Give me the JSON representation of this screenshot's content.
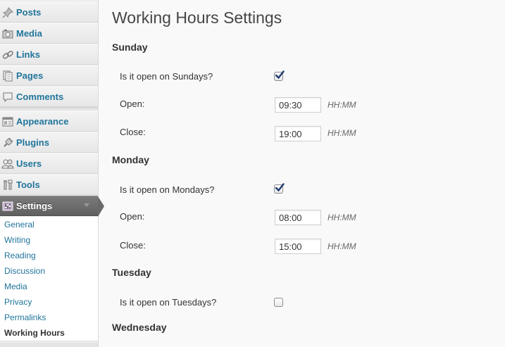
{
  "sidebar": {
    "items": [
      {
        "label": "Posts",
        "icon": "pushpin-icon"
      },
      {
        "label": "Media",
        "icon": "media-icon"
      },
      {
        "label": "Links",
        "icon": "link-icon"
      },
      {
        "label": "Pages",
        "icon": "pages-icon"
      },
      {
        "label": "Comments",
        "icon": "comment-icon"
      },
      {
        "label": "Appearance",
        "icon": "appearance-icon"
      },
      {
        "label": "Plugins",
        "icon": "plug-icon"
      },
      {
        "label": "Users",
        "icon": "users-icon"
      },
      {
        "label": "Tools",
        "icon": "tools-icon"
      },
      {
        "label": "Settings",
        "icon": "settings-icon"
      }
    ],
    "settings_submenu": [
      "General",
      "Writing",
      "Reading",
      "Discussion",
      "Media",
      "Privacy",
      "Permalinks",
      "Working Hours"
    ],
    "active_submenu": "Working Hours",
    "accent_color": "#21759b"
  },
  "page": {
    "title": "Working Hours Settings",
    "sunday": {
      "heading": "Sunday",
      "open_question": "Is it open on Sundays?",
      "checked": true,
      "open_label": "Open:",
      "open_value": "09:30",
      "close_label": "Close:",
      "close_value": "19:00",
      "hint": "HH:MM"
    },
    "monday": {
      "heading": "Monday",
      "open_question": "Is it open on Mondays?",
      "checked": true,
      "open_label": "Open:",
      "open_value": "08:00",
      "close_label": "Close:",
      "close_value": "15:00",
      "hint": "HH:MM"
    },
    "tuesday": {
      "heading": "Tuesday",
      "open_question": "Is it open on Tuesdays?",
      "checked": false
    },
    "wednesday": {
      "heading": "Wednesday"
    }
  }
}
